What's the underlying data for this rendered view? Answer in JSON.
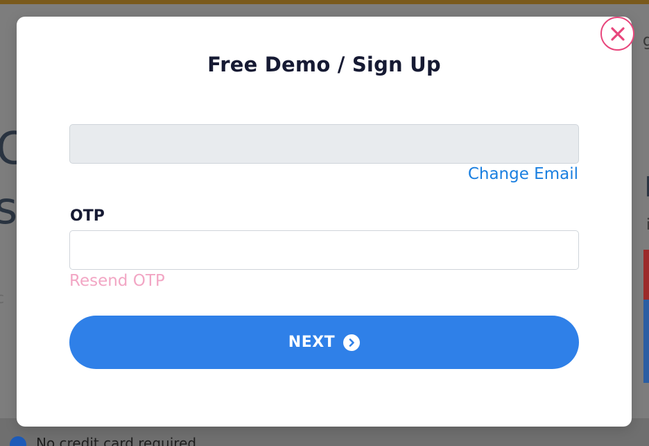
{
  "modal": {
    "title": "Free Demo / Sign Up",
    "email": {
      "value": "",
      "change_email_label": "Change Email"
    },
    "otp": {
      "label": "OTP",
      "value": "",
      "resend_label": "Resend OTP"
    },
    "next_button": {
      "label": "NEXT"
    }
  },
  "background": {
    "bottom_text": "No credit card required"
  },
  "icons": {
    "close": "close-icon",
    "next": "chevron-right-circle-icon",
    "check": "check-circle-icon"
  },
  "colors": {
    "accent_blue": "#2f80e8",
    "link_blue": "#1a7fe0",
    "close_pink": "#e8467c",
    "resend_pink": "#f2a6c4",
    "title_dark": "#161a33",
    "disabled_field": "#e8ebee"
  }
}
